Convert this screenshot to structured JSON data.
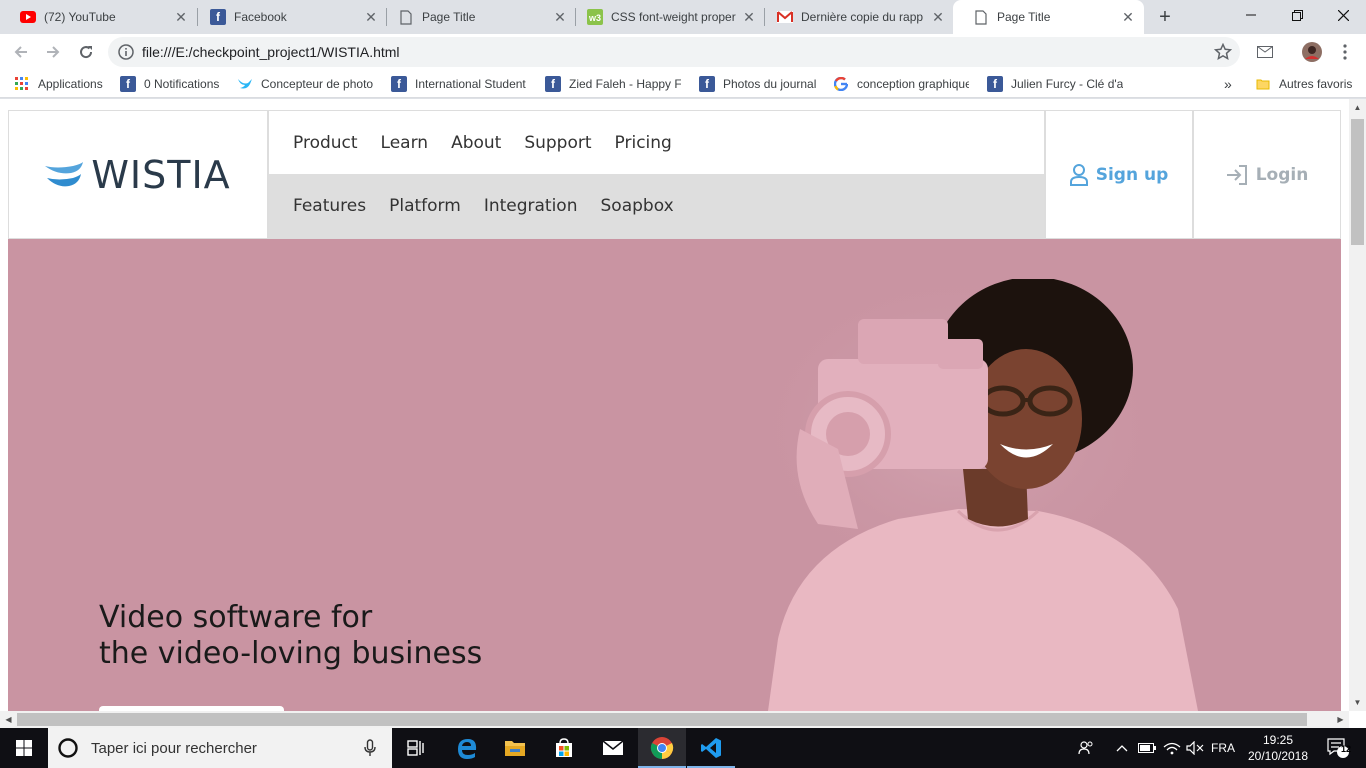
{
  "browser": {
    "tabs": [
      {
        "title": "(72) YouTube",
        "icon": "youtube-icon"
      },
      {
        "title": "Facebook",
        "icon": "facebook-icon"
      },
      {
        "title": "Page Title",
        "icon": "page-icon"
      },
      {
        "title": "CSS font-weight proper",
        "icon": "w3schools-icon"
      },
      {
        "title": "Dernière copie du rapp",
        "icon": "gmail-icon"
      },
      {
        "title": "Page Title",
        "icon": "page-icon",
        "active": true
      }
    ],
    "url": "file:///E:/checkpoint_project1/WISTIA.html",
    "bookmarks": [
      {
        "label": "Applications",
        "icon": "apps-grid-icon"
      },
      {
        "label": "0 Notifications",
        "icon": "facebook-icon"
      },
      {
        "label": "Concepteur de photo",
        "icon": "bird-icon"
      },
      {
        "label": "International Student",
        "icon": "facebook-icon"
      },
      {
        "label": "Zied Faleh - Happy Fa",
        "icon": "facebook-icon"
      },
      {
        "label": "Photos du journal",
        "icon": "facebook-icon"
      },
      {
        "label": "conception graphique",
        "icon": "google-icon"
      },
      {
        "label": "Julien Furcy - Clé d'ac",
        "icon": "facebook-icon"
      }
    ],
    "more_bookmarks": "»",
    "other_bookmarks": "Autres favoris"
  },
  "site": {
    "logo_text": "WISTIA",
    "nav_top": [
      "Product",
      "Learn",
      "About",
      "Support",
      "Pricing"
    ],
    "nav_bottom": [
      "Features",
      "Platform",
      "Integration",
      "Soapbox"
    ],
    "signup": "Sign up",
    "login": "Login",
    "hero_line1": "Video software for",
    "hero_line2": "the video-loving business",
    "colors": {
      "hero_bg": "#c994a2",
      "accent": "#54a4dc",
      "muted": "#a6afb6"
    }
  },
  "taskbar": {
    "search_placeholder": "Taper ici pour rechercher",
    "language": "FRA",
    "time": "19:25",
    "date": "20/10/2018",
    "notifications": "12"
  }
}
